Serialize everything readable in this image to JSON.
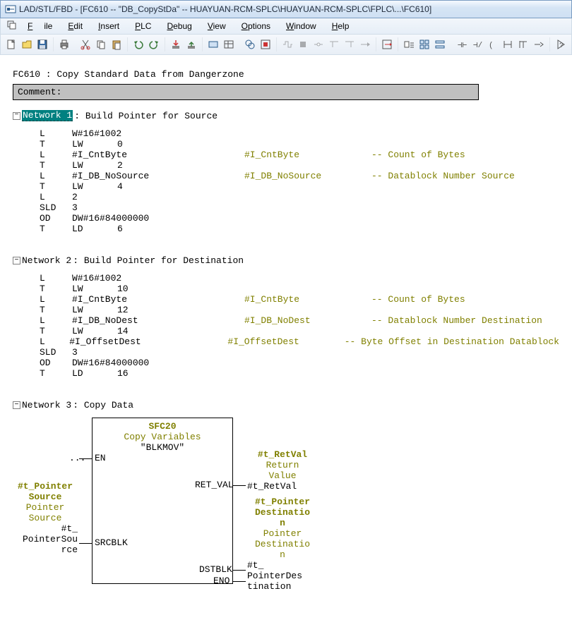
{
  "window": {
    "title": "LAD/STL/FBD  - [FC610 -- \"DB_CopyStDa\" -- HUAYUAN-RCM-SPLC\\HUAYUAN-RCM-SPLC\\FPLC\\...\\FC610]"
  },
  "menu": {
    "file": "File",
    "edit": "Edit",
    "insert": "Insert",
    "plc": "PLC",
    "debug": "Debug",
    "view": "View",
    "options": "Options",
    "window": "Window",
    "help": "Help"
  },
  "fc": {
    "name": "FC610 : Copy Standard Data from Dangerzone",
    "comment_label": "Comment:"
  },
  "net1": {
    "header_label": "Network 1",
    "header_rest": ": Build Pointer for Source",
    "rows": [
      {
        "inst": "L",
        "op1": "W#16#1002"
      },
      {
        "inst": "T",
        "op1": "LW",
        "op2": "0"
      },
      {
        "inst": "L",
        "op1": "#I_CntByte",
        "sym": "#I_CntByte",
        "desc": "-- Count of Bytes"
      },
      {
        "inst": "T",
        "op1": "LW",
        "op2": "2"
      },
      {
        "inst": "L",
        "op1": "#I_DB_NoSource",
        "sym": "#I_DB_NoSource",
        "desc": "-- Datablock Number Source"
      },
      {
        "inst": "T",
        "op1": "LW",
        "op2": "4"
      },
      {
        "inst": "L",
        "op1": "2"
      },
      {
        "inst": "SLD",
        "op1": "3"
      },
      {
        "inst": "OD",
        "op1": "DW#16#84000000"
      },
      {
        "inst": "T",
        "op1": "LD",
        "op2": "6"
      }
    ]
  },
  "net2": {
    "header_label": "Network 2",
    "header_rest": ": Build Pointer for Destination",
    "rows": [
      {
        "inst": "L",
        "op1": "W#16#1002"
      },
      {
        "inst": "T",
        "op1": "LW",
        "op2": "10"
      },
      {
        "inst": "L",
        "op1": "#I_CntByte",
        "sym": "#I_CntByte",
        "desc": "-- Count of Bytes"
      },
      {
        "inst": "T",
        "op1": "LW",
        "op2": "12"
      },
      {
        "inst": "L",
        "op1": "#I_DB_NoDest",
        "sym": "#I_DB_NoDest",
        "desc": "-- Datablock Number Destination"
      },
      {
        "inst": "T",
        "op1": "LW",
        "op2": "14"
      },
      {
        "inst": "L",
        "op1": "#I_OffsetDest",
        "sym": "#I_OffsetDest",
        "desc": "-- Byte Offset in Destination Datablock"
      },
      {
        "inst": "SLD",
        "op1": "3"
      },
      {
        "inst": "OD",
        "op1": "DW#16#84000000"
      },
      {
        "inst": "T",
        "op1": "LD",
        "op2": "16"
      }
    ]
  },
  "net3": {
    "header_label": "Network 3",
    "header_rest": ": Copy Data",
    "block_title": "SFC20",
    "block_sub1": "Copy Variables",
    "block_sub2": "\"BLKMOV\"",
    "en": "EN",
    "srcblk": "SRCBLK",
    "retval_pin": "RET_VAL",
    "dstblk_pin": "DSTBLK",
    "eno": "ENO",
    "dots": "...",
    "left_var_line1": "#t_Pointer",
    "left_var_line2": "Source",
    "left_var_desc1": "Pointer",
    "left_var_desc2": "Source",
    "left_wrap1": "#t_",
    "left_wrap2": "PointerSou",
    "left_wrap3": "rce",
    "right_var_line1": "#t_RetVal",
    "right_var_desc1": "Return",
    "right_var_desc2": "Value",
    "right_wrap_ret": "#t_RetVal",
    "right_var2_line1": "#t_Pointer",
    "right_var2_line2": "Destinatio",
    "right_var2_line3": "n",
    "right_var2_desc1": "Pointer",
    "right_var2_desc2": "Destinatio",
    "right_var2_desc3": "n",
    "right_wrap1": "#t_",
    "right_wrap2": "PointerDes",
    "right_wrap3": "tination"
  }
}
